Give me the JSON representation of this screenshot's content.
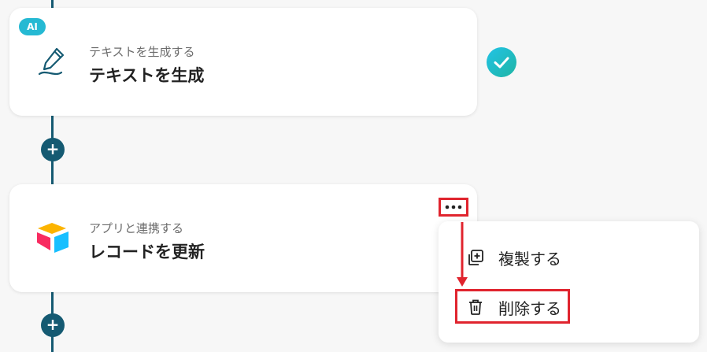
{
  "steps": [
    {
      "badge": "AI",
      "subtitle": "テキストを生成する",
      "title": "テキストを生成",
      "icon": "pen-icon",
      "status": "completed"
    },
    {
      "subtitle": "アプリと連携する",
      "title": "レコードを更新",
      "icon": "airtable-logo"
    }
  ],
  "context_menu": {
    "items": [
      {
        "label": "複製する",
        "icon": "duplicate-icon"
      },
      {
        "label": "削除する",
        "icon": "trash-icon"
      }
    ]
  },
  "colors": {
    "flow_line": "#155a72",
    "ai_badge": "#25b9d3",
    "highlight": "#e0242e",
    "check": "#22c3e6"
  }
}
